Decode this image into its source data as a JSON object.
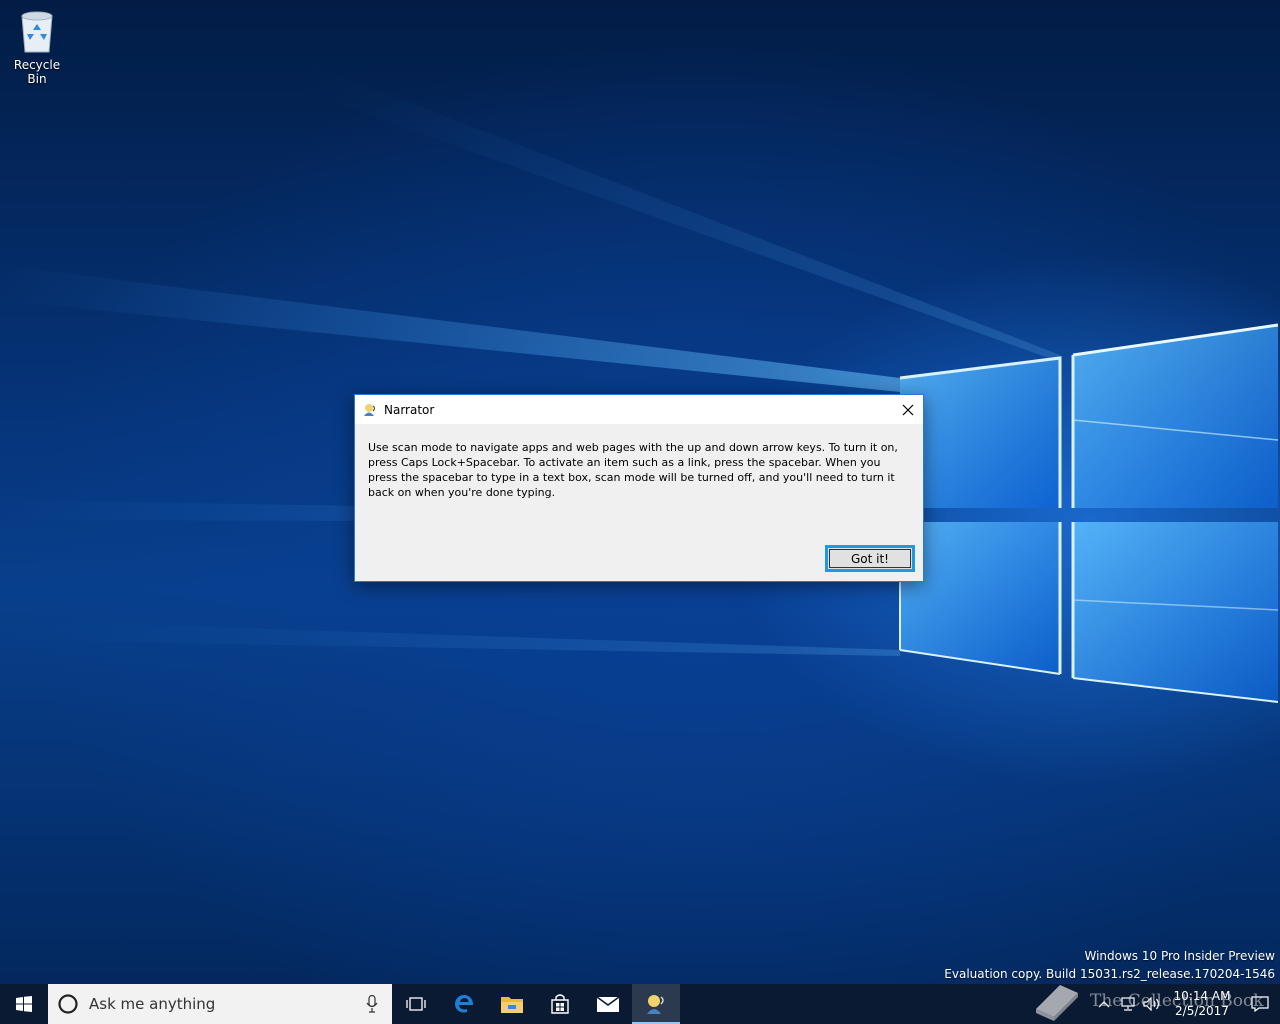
{
  "desktop": {
    "icons": [
      {
        "label": "Recycle Bin",
        "icon": "recycle-bin-icon"
      }
    ],
    "watermark": {
      "line1": "Windows 10 Pro Insider Preview",
      "line2": "Evaluation copy. Build 15031.rs2_release.170204-1546"
    },
    "overlay_brand": "The Collection Book"
  },
  "dialog": {
    "title": "Narrator",
    "message": "Use scan mode to navigate apps and web pages with the up and down arrow keys. To turn it on, press Caps Lock+Spacebar. To activate an item such as a link, press the spacebar. When you press the spacebar to type in a text box, scan mode will be turned off, and you'll need to turn it back on when you're done typing.",
    "primary_button": "Got it!",
    "accent": "#1b9be6"
  },
  "taskbar": {
    "search_placeholder": "Ask me anything",
    "pinned": [
      "task-view-icon",
      "edge-icon",
      "file-explorer-icon",
      "store-icon",
      "mail-icon",
      "narrator-icon"
    ],
    "clock": {
      "time": "10:14 AM",
      "date": "2/5/2017"
    }
  }
}
